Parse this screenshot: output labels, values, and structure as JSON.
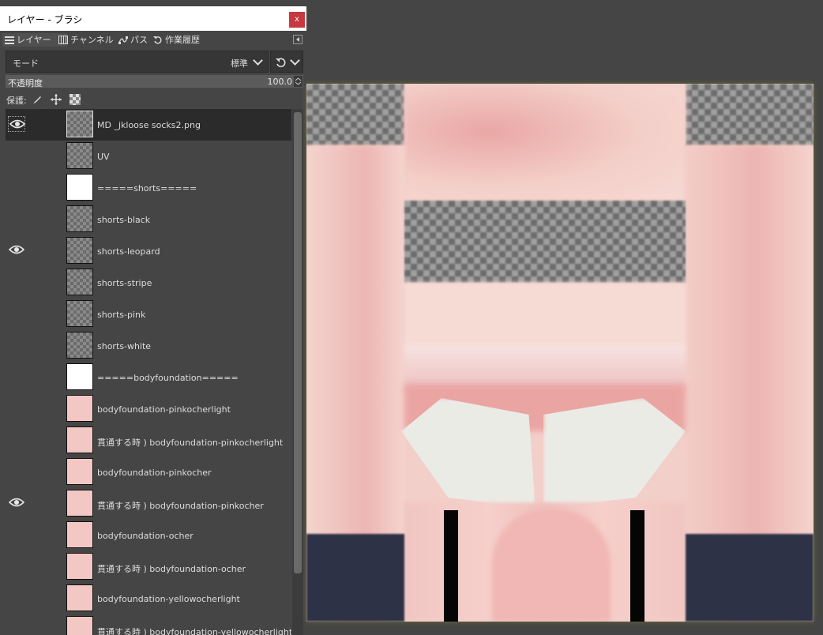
{
  "window": {
    "title": "レイヤー - ブラシ",
    "close_label": "x"
  },
  "tabs": [
    {
      "label": "レイヤー",
      "icon": "layers-icon"
    },
    {
      "label": "チャンネル",
      "icon": "channels-icon"
    },
    {
      "label": "パス",
      "icon": "paths-icon"
    },
    {
      "label": "作業履歴",
      "icon": "undo-history-icon"
    }
  ],
  "mode": {
    "label": "モード",
    "value": "標準"
  },
  "opacity": {
    "label": "不透明度",
    "value": "100.0"
  },
  "protect": {
    "label": "保護:"
  },
  "layers": [
    {
      "name": "MD _jkloose socks2.png",
      "visible": true,
      "selected": true,
      "thumb": "checker"
    },
    {
      "name": "UV",
      "visible": false,
      "selected": false,
      "thumb": "checker"
    },
    {
      "name": "=====shorts=====",
      "visible": false,
      "selected": false,
      "thumb": "white"
    },
    {
      "name": "shorts-black",
      "visible": false,
      "selected": false,
      "thumb": "checker"
    },
    {
      "name": "shorts-leopard",
      "visible": true,
      "selected": false,
      "thumb": "checker"
    },
    {
      "name": "shorts-stripe",
      "visible": false,
      "selected": false,
      "thumb": "checker"
    },
    {
      "name": "shorts-pink",
      "visible": false,
      "selected": false,
      "thumb": "checker"
    },
    {
      "name": "shorts-white",
      "visible": false,
      "selected": false,
      "thumb": "checker"
    },
    {
      "name": "=====bodyfoundation=====",
      "visible": false,
      "selected": false,
      "thumb": "white"
    },
    {
      "name": "bodyfoundation-pinkocherlight",
      "visible": false,
      "selected": false,
      "thumb": "pink"
    },
    {
      "name": "貫通する時 ) bodyfoundation-pinkocherlight",
      "visible": false,
      "selected": false,
      "thumb": "pink"
    },
    {
      "name": "bodyfoundation-pinkocher",
      "visible": false,
      "selected": false,
      "thumb": "pink"
    },
    {
      "name": "貫通する時 ) bodyfoundation-pinkocher",
      "visible": true,
      "selected": false,
      "thumb": "pink"
    },
    {
      "name": "bodyfoundation-ocher",
      "visible": false,
      "selected": false,
      "thumb": "pink"
    },
    {
      "name": "貫通する時 ) bodyfoundation-ocher",
      "visible": false,
      "selected": false,
      "thumb": "pink"
    },
    {
      "name": "bodyfoundation-yellowocherlight",
      "visible": false,
      "selected": false,
      "thumb": "pink"
    },
    {
      "name": "貫通する時 ) bodyfoundation-yellowocherlight",
      "visible": false,
      "selected": false,
      "thumb": "pink"
    }
  ],
  "colors": {
    "panel_bg": "#454545",
    "selected_row": "#2b2b2b",
    "close_button": "#c8393f",
    "skin_pink": "#f3cfca",
    "sock_navy": "#2e3247",
    "shirt_white": "#ebebe6"
  }
}
